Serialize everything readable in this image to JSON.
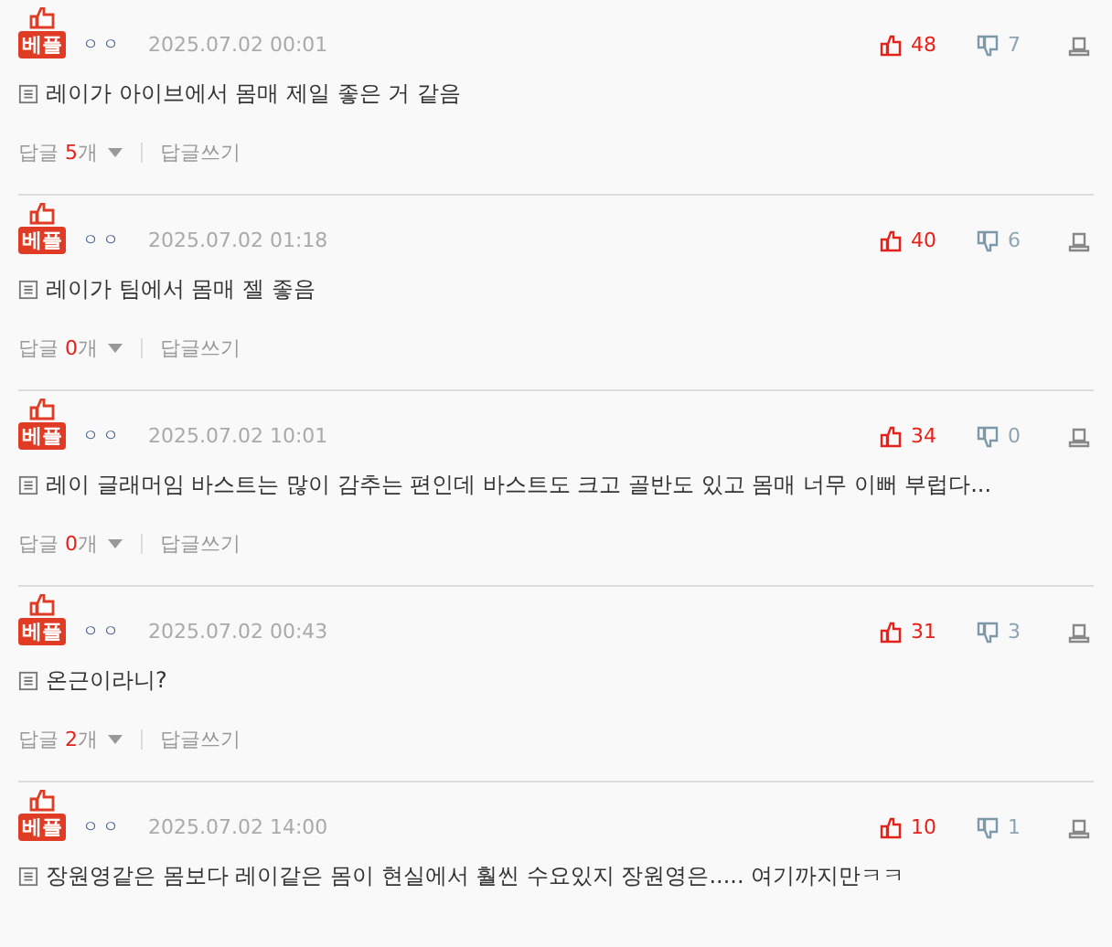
{
  "comments": [
    {
      "badge": "베플",
      "author": "ㅇㅇ",
      "date": "2025.07.02 00:01",
      "upvotes": "48",
      "downvotes": "7",
      "text": "레이가 아이브에서 몸매 제일 좋은 거 같음",
      "replies": {
        "label": "답글",
        "count": "5",
        "unit": "개",
        "write": "답글쓰기"
      }
    },
    {
      "badge": "베플",
      "author": "ㅇㅇ",
      "date": "2025.07.02 01:18",
      "upvotes": "40",
      "downvotes": "6",
      "text": "레이가 팀에서 몸매 젤 좋음",
      "replies": {
        "label": "답글",
        "count": "0",
        "unit": "개",
        "write": "답글쓰기"
      }
    },
    {
      "badge": "베플",
      "author": "ㅇㅇ",
      "date": "2025.07.02 10:01",
      "upvotes": "34",
      "downvotes": "0",
      "text": "레이 글래머임 바스트는 많이 감추는 편인데 바스트도 크고 골반도 있고 몸매 너무 이뻐 부럽다...",
      "replies": {
        "label": "답글",
        "count": "0",
        "unit": "개",
        "write": "답글쓰기"
      }
    },
    {
      "badge": "베플",
      "author": "ㅇㅇ",
      "date": "2025.07.02 00:43",
      "upvotes": "31",
      "downvotes": "3",
      "text": "온근이라니?",
      "replies": {
        "label": "답글",
        "count": "2",
        "unit": "개",
        "write": "답글쓰기"
      }
    },
    {
      "badge": "베플",
      "author": "ㅇㅇ",
      "date": "2025.07.02 14:00",
      "upvotes": "10",
      "downvotes": "1",
      "text": "장원영같은 몸보다 레이같은 몸이 현실에서 훨씬 수요있지 장원영은..... 여기까지만ㅋㅋ"
    }
  ]
}
